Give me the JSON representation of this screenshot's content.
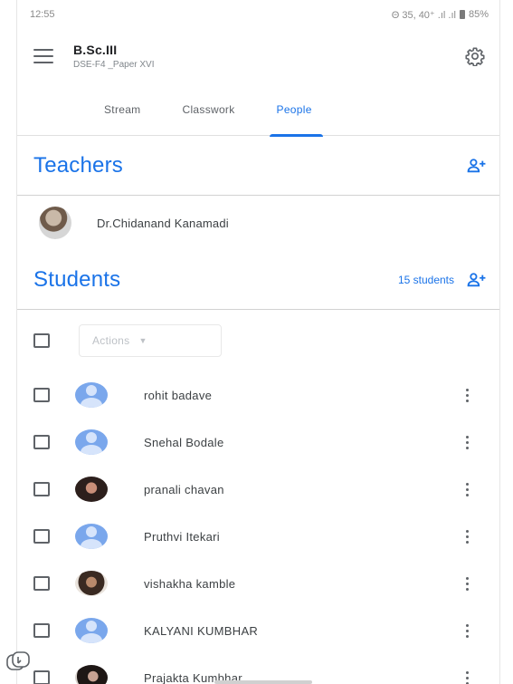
{
  "status_bar": {
    "time": "12:55",
    "indicators": "Θ 35, 40⁺ .ıl .ıl",
    "battery": "85%"
  },
  "app_bar": {
    "class_title": "B.Sc.III",
    "class_subtitle": "DSE-F4 _Paper XVI"
  },
  "tabs": [
    {
      "label": "Stream",
      "active": false
    },
    {
      "label": "Classwork",
      "active": false
    },
    {
      "label": "People",
      "active": true
    }
  ],
  "teachers": {
    "title": "Teachers",
    "list": [
      {
        "name": "Dr.Chidanand Kanamadi"
      }
    ]
  },
  "students": {
    "title": "Students",
    "count": "15 students",
    "actions_label": "Actions",
    "list": [
      {
        "name": "rohit badave",
        "avatar": "default"
      },
      {
        "name": "Snehal Bodale",
        "avatar": "default"
      },
      {
        "name": "pranali chavan",
        "avatar": "photo1"
      },
      {
        "name": "Pruthvi Itekari",
        "avatar": "default"
      },
      {
        "name": "vishakha kamble",
        "avatar": "photo2"
      },
      {
        "name": "KALYANI KUMBHAR",
        "avatar": "default"
      },
      {
        "name": "Prajakta Kumbhar",
        "avatar": "photo3"
      }
    ]
  },
  "colors": {
    "accent": "#1a73e8",
    "default_avatar": "#7aa7ec",
    "text": "#3c4043"
  },
  "icons": [
    "menu-icon",
    "gear-icon",
    "add-person-icon",
    "more-vert-icon",
    "chevron-down-icon",
    "screenshot-overlay-icon"
  ]
}
